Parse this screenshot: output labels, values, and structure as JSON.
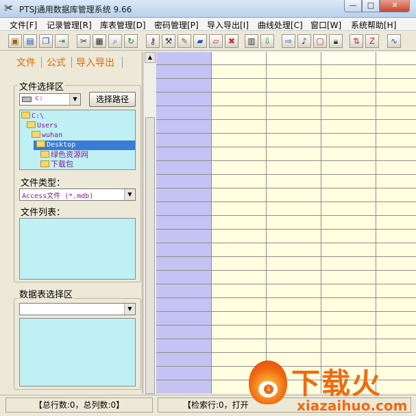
{
  "window": {
    "title": "PTSJ通用数据库管理系统 9.66",
    "minimize_glyph": "—",
    "maximize_glyph": "□",
    "close_glyph": "✕"
  },
  "menu": [
    "文件[F]",
    "记录管理[R]",
    "库表管理[D]",
    "密码管理[P]",
    "导入导出[I]",
    "曲线处理[C]",
    "窗口[W]",
    "系统帮助[H]"
  ],
  "toolbar": {
    "icons": [
      "new-db-icon",
      "open-db-icon",
      "copy-db-icon",
      "exit-icon",
      "tools-icon",
      "grid-icon",
      "search-icon",
      "refresh-icon",
      "key-icon",
      "settings-icon",
      "edit-icon",
      "book-icon",
      "book-edit-icon",
      "delete-icon",
      "calculator-icon",
      "import-icon",
      "export-icon",
      "chart-edit-icon",
      "frame-icon",
      "lock-icon",
      "sort-icon",
      "arrange-icon",
      "line-chart-icon"
    ]
  },
  "left": {
    "tabs": [
      "文件",
      "公式",
      "导入导出"
    ],
    "file_section": {
      "legend": "文件选择区",
      "drive": "c:",
      "browse_button": "选择路径",
      "tree": [
        {
          "label": "C:\\",
          "indent": 0,
          "selected": false
        },
        {
          "label": "Users",
          "indent": 1,
          "selected": false
        },
        {
          "label": "wuhan",
          "indent": 2,
          "selected": false
        },
        {
          "label": "Desktop",
          "indent": 3,
          "selected": true
        },
        {
          "label": "绿色资源网",
          "indent": 4,
          "selected": false
        },
        {
          "label": "下载包",
          "indent": 4,
          "selected": false
        }
      ],
      "type_label": "文件类型：",
      "type_value": "Access文件 (*.mdb)",
      "list_label": "文件列表："
    },
    "table_section": {
      "legend": "数据表选择区",
      "table_value": ""
    }
  },
  "status": {
    "left": "【总行数:0，总列数:0】",
    "right": "【检索行:0，打开"
  },
  "watermark": {
    "cn": "下载火",
    "en": "xiazaihuo.com"
  },
  "colors": {
    "header_col": "#c4c4f4",
    "cell": "#ffffe0",
    "gridline": "#8c8c8c",
    "tree_bg": "#bff0f4",
    "tab_text": "#e06800"
  }
}
